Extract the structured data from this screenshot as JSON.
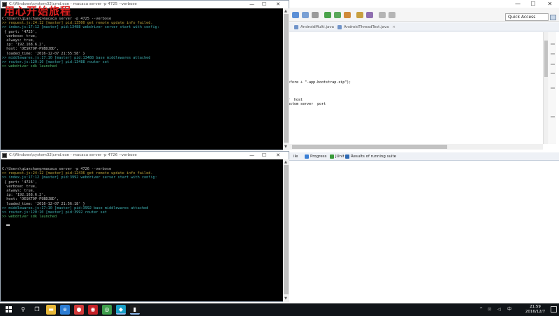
{
  "overlay_caption": "用心开始旅程",
  "ide": {
    "window_controls": {
      "minimize": "—",
      "maximize": "☐",
      "close": "✕"
    },
    "quick_access_placeholder": "Quick Access",
    "editor_tabs": [
      {
        "label": "AndroidMulti.java"
      },
      {
        "label": "AndroidThreadTest.java"
      }
    ],
    "code_lines": {
      "line_before": "efore + \"-app-bootstrap.zip\");",
      "line_host": "r  host",
      "line_port": "ustom server  port"
    },
    "bottom_tabs": [
      {
        "label": "ile",
        "icon": "console-view-icon",
        "color": "#8a8a8a"
      },
      {
        "label": "Progress",
        "icon": "progress-icon",
        "color": "#3b7fd4"
      },
      {
        "label": "JUnit",
        "icon": "junit-icon",
        "color": "#3a9a3a"
      },
      {
        "label": "Results of running suite",
        "icon": "testng-results-icon",
        "color": "#2f6ab3"
      }
    ]
  },
  "console_top": {
    "title": "C:\\Windows\\system32\\cmd.exe - macaca  server -p 4725 --verbose",
    "lines": [
      {
        "text": "C:\\Users\\qianchang>macaca server -p 4725 --verbose",
        "color": "white"
      },
      {
        "text": ">> request.js:24:12 [master] pid:13500 get remote update info failed.",
        "color": "yellow"
      },
      {
        "text": ">> index.js:17:12 [master] pid:13488 webdriver server start with config:",
        "color": "teal"
      },
      {
        "text": " { port: '4725',",
        "color": "white"
      },
      {
        "text": "  verbose: true,",
        "color": "white"
      },
      {
        "text": "  always: true,",
        "color": "white"
      },
      {
        "text": "  ip: '192.168.6.2',",
        "color": "white"
      },
      {
        "text": "  host: 'DESKTOP-P9BDJ8D',",
        "color": "white"
      },
      {
        "text": "  loaded_time: '2016-12-07 21:55:58' }",
        "color": "white"
      },
      {
        "text": ">> middlewares.js:17:10 [master] pid:13488 base middlewares attached",
        "color": "teal"
      },
      {
        "text": ">> router.js:120:10 [master] pid:13488 router set",
        "color": "teal"
      },
      {
        "text": ">> webdriver sdk launched",
        "color": "green"
      }
    ]
  },
  "console_bottom": {
    "title": "C:\\Windows\\system32\\cmd.exe - macaca  server -p 4726 --verbose",
    "lines": [
      {
        "text": "C:\\Users\\qianchang>macaca server -p 4726 --verbose",
        "color": "white"
      },
      {
        "text": ">> request.js:24:12 [master] pid:12436 get remote update info failed.",
        "color": "yellow"
      },
      {
        "text": ">> index.js:17:12 [master] pid:3992 webdriver server start with config:",
        "color": "teal"
      },
      {
        "text": " { port: '4726',",
        "color": "white"
      },
      {
        "text": "  verbose: true,",
        "color": "white"
      },
      {
        "text": "  always: true,",
        "color": "white"
      },
      {
        "text": "  ip: '192.168.6.2',",
        "color": "white"
      },
      {
        "text": "  host: 'DESKTOP-P9BDJ8D',",
        "color": "white"
      },
      {
        "text": "  loaded_time: '2016-12-07 21:56:18' }",
        "color": "white"
      },
      {
        "text": ">> middlewares.js:17:10 [master] pid:3992 base middlewares attached",
        "color": "teal"
      },
      {
        "text": ">> router.js:120:10 [master] pid:3992 router set",
        "color": "teal"
      },
      {
        "text": ">> webdriver sdk launched",
        "color": "green"
      }
    ]
  },
  "taskbar": {
    "apps": [
      {
        "name": "search-icon",
        "glyph": "⚲",
        "bg": "#101418"
      },
      {
        "name": "task-view-icon",
        "glyph": "❐",
        "bg": "#101418"
      },
      {
        "name": "file-explorer-icon",
        "glyph": "▬",
        "bg": "#e8b838"
      },
      {
        "name": "edge-icon",
        "glyph": "e",
        "bg": "#2b7cd3"
      },
      {
        "name": "media-app-icon",
        "glyph": "●",
        "bg": "#d23a3a"
      },
      {
        "name": "netease-icon",
        "glyph": "◉",
        "bg": "#c42127"
      },
      {
        "name": "chrome-icon",
        "glyph": "◎",
        "bg": "#3e9d4c"
      },
      {
        "name": "android-tool-icon",
        "glyph": "◆",
        "bg": "#19a0c8"
      },
      {
        "name": "cmd-icon",
        "glyph": "▮",
        "bg": "#1c1c1c"
      }
    ],
    "tray": {
      "ime": "中",
      "network": "⊡",
      "volume": "◁",
      "chevron": "^"
    },
    "clock_time": "21:59",
    "clock_date": "2016/12/7"
  }
}
